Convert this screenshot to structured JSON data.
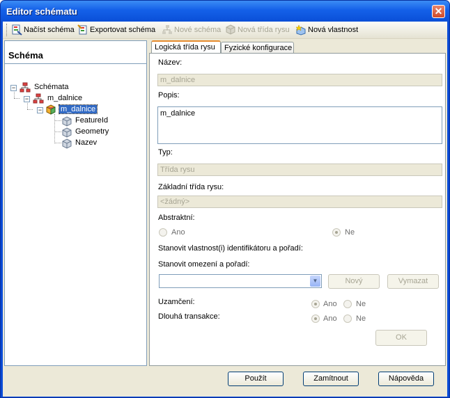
{
  "window": {
    "title": "Editor schématu",
    "close_glyph": "✕"
  },
  "toolbar": {
    "load": "Načíst schéma",
    "export": "Exportovat schéma",
    "new_schema": "Nové schéma",
    "new_class": "Nová třída rysu",
    "new_property": "Nová vlastnost"
  },
  "schema_panel": {
    "title": "Schéma",
    "tree": {
      "root": "Schémata",
      "child": "m_dalnice",
      "selected": "m_dalnice",
      "leaves": [
        "FeatureId",
        "Geometry",
        "Nazev"
      ]
    }
  },
  "tabs": [
    "Logická třída rysu",
    "Fyzické konfigurace"
  ],
  "form": {
    "name_label": "Název:",
    "name_value": "m_dalnice",
    "desc_label": "Popis:",
    "desc_value": "m_dalnice",
    "type_label": "Typ:",
    "type_value": "Třída rysu",
    "base_label": "Základní třída rysu:",
    "base_value": "<žádný>",
    "abstract_label": "Abstraktní:",
    "yes": "Ano",
    "no": "Ne",
    "identity_label": "Stanovit vlastnost(i) identifikátoru a pořadí:",
    "constraints_label": "Stanovit omezení a pořadí:",
    "constraints_value": "",
    "new_btn": "Nový",
    "delete_btn": "Vymazat",
    "locking_label": "Uzamčení:",
    "long_tx_label": "Dlouhá transakce:",
    "ok_btn": "OK"
  },
  "footer": {
    "apply": "Použít",
    "cancel": "Zamítnout",
    "help": "Nápověda"
  }
}
